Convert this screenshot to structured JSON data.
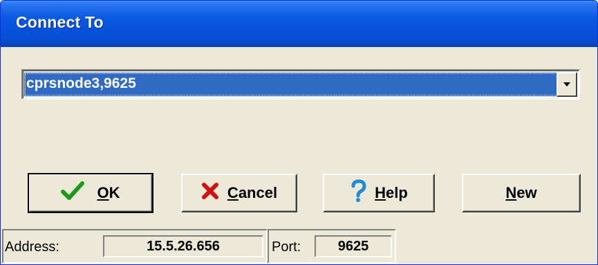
{
  "window": {
    "title": "Connect To"
  },
  "server_combo": {
    "selected_value": "cprsnode3,9625"
  },
  "buttons": {
    "ok": {
      "underline_char": "O",
      "rest": "K",
      "icon": "check-icon"
    },
    "cancel": {
      "underline_char": "C",
      "rest": "ancel",
      "icon": "x-icon"
    },
    "help": {
      "underline_char": "H",
      "rest": "elp",
      "icon": "question-icon"
    },
    "new": {
      "underline_char": "N",
      "rest": "ew"
    }
  },
  "status": {
    "address_label": "Address:",
    "address_value": "15.5.26.656",
    "port_label": "Port:",
    "port_value": "9625"
  },
  "colors": {
    "title_blue": "#0750d9",
    "selection_blue": "#316ac5",
    "face": "#ece9d8",
    "check_green": "#1a9a1a",
    "cancel_red": "#d01010",
    "help_blue": "#1e8bd6"
  }
}
